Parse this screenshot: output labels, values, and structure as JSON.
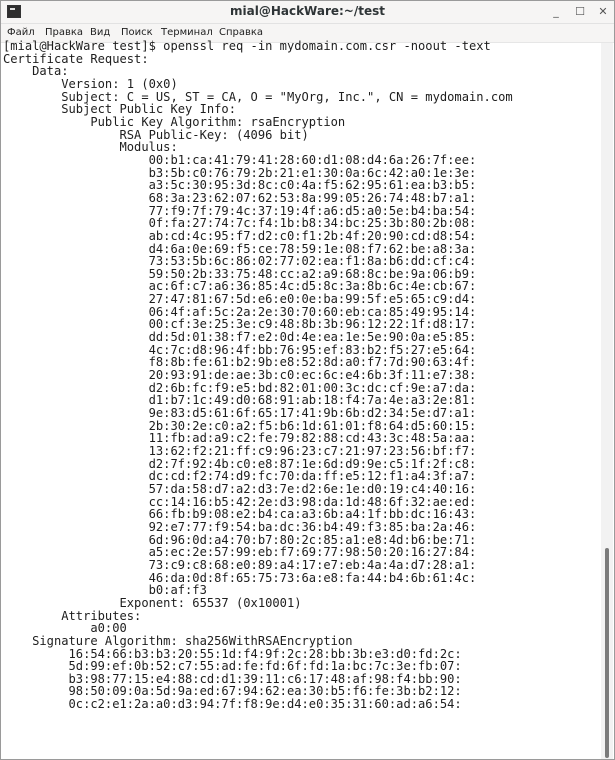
{
  "window": {
    "title": "mial@HackWare:~/test",
    "controls": {
      "minimize": "_",
      "maximize": "☐",
      "close": "✕"
    }
  },
  "menu": {
    "items": [
      "Файл",
      "Правка",
      "Вид",
      "Поиск",
      "Терминал",
      "Справка"
    ]
  },
  "terminal": {
    "lines": [
      "[mial@HackWare test]$ openssl req -in mydomain.com.csr -noout -text",
      "Certificate Request:",
      "    Data:",
      "        Version: 1 (0x0)",
      "        Subject: C = US, ST = CA, O = \"MyOrg, Inc.\", CN = mydomain.com",
      "        Subject Public Key Info:",
      "            Public Key Algorithm: rsaEncryption",
      "                RSA Public-Key: (4096 bit)",
      "                Modulus:",
      "                    00:b1:ca:41:79:41:28:60:d1:08:d4:6a:26:7f:ee:",
      "                    b3:5b:c0:76:79:2b:21:e1:30:0a:6c:42:a0:1e:3e:",
      "                    a3:5c:30:95:3d:8c:c0:4a:f5:62:95:61:ea:b3:b5:",
      "                    68:3a:23:62:07:62:53:8a:99:05:26:74:48:b7:a1:",
      "                    77:f9:7f:79:4c:37:19:4f:a6:d5:a0:5e:b4:ba:54:",
      "                    0f:fa:27:74:7c:f4:1b:b8:34:bc:25:3b:80:2b:08:",
      "                    ab:cd:4c:95:f7:d2:c0:f1:2b:4f:20:90:cd:d8:54:",
      "                    d4:6a:0e:69:f5:ce:78:59:1e:08:f7:62:be:a8:3a:",
      "                    73:53:5b:6c:86:02:77:02:ea:f1:8a:b6:dd:cf:c4:",
      "                    59:50:2b:33:75:48:cc:a2:a9:68:8c:be:9a:06:b9:",
      "                    ac:6f:c7:a6:36:85:4c:d5:8c:3a:8b:6c:4e:cb:67:",
      "                    27:47:81:67:5d:e6:e0:0e:ba:99:5f:e5:65:c9:d4:",
      "                    06:4f:af:5c:2a:2e:30:70:60:eb:ca:85:49:95:14:",
      "                    00:cf:3e:25:3e:c9:48:8b:3b:96:12:22:1f:d8:17:",
      "                    dd:5d:01:38:f7:e2:0d:4e:ea:1e:5e:90:0a:e5:85:",
      "                    4c:7c:d8:96:4f:bb:76:95:ef:83:b2:f5:27:e5:64:",
      "                    f8:8b:fe:61:b2:9b:e8:52:8d:a0:f7:7d:90:63:4f:",
      "                    20:93:91:de:ae:3b:c0:ec:6c:e4:6b:3f:11:e7:38:",
      "                    d2:6b:fc:f9:e5:bd:82:01:00:3c:dc:cf:9e:a7:da:",
      "                    d1:b7:1c:49:d0:68:91:ab:18:f4:7a:4e:a3:2e:81:",
      "                    9e:83:d5:61:6f:65:17:41:9b:6b:d2:34:5e:d7:a1:",
      "                    2b:30:2e:c0:a2:f5:b6:1d:61:01:f8:64:d5:60:15:",
      "                    11:fb:ad:a9:c2:fe:79:82:88:cd:43:3c:48:5a:aa:",
      "                    13:62:f2:21:ff:c9:96:23:c7:21:97:23:56:bf:f7:",
      "                    d2:7f:92:4b:c0:e8:87:1e:6d:d9:9e:c5:1f:2f:c8:",
      "                    dc:cd:f2:74:d9:fc:70:da:ff:e5:12:f1:a4:3f:a7:",
      "                    57:da:58:d7:a2:d3:7e:d2:6e:1e:d0:19:c4:40:16:",
      "                    cc:14:16:b5:42:2e:d3:98:da:1d:48:6f:32:ae:ed:",
      "                    66:fb:b9:08:e2:b4:ca:a3:6b:a4:1f:bb:dc:16:43:",
      "                    92:e7:77:f9:54:ba:dc:36:b4:49:f3:85:ba:2a:46:",
      "                    6d:96:0d:a4:70:b7:80:2c:85:a1:e8:4d:b6:be:71:",
      "                    a5:ec:2e:57:99:eb:f7:69:77:98:50:20:16:27:84:",
      "                    73:c9:c8:68:e0:89:a4:17:e7:eb:4a:4a:d7:28:a1:",
      "                    46:da:0d:8f:65:75:73:6a:e8:fa:44:b4:6b:61:4c:",
      "                    b0:af:f3",
      "                Exponent: 65537 (0x10001)",
      "        Attributes:",
      "            a0:00",
      "    Signature Algorithm: sha256WithRSAEncryption",
      "         16:54:66:b3:b3:20:55:1d:f4:9f:2c:28:bb:3b:e3:d0:fd:2c:",
      "         5d:99:ef:0b:52:c7:55:ad:fe:fd:6f:fd:1a:bc:7c:3e:fb:07:",
      "         b3:98:77:15:e4:88:cd:d1:39:11:c6:17:48:af:98:f4:bb:90:",
      "         98:50:09:0a:5d:9a:ed:67:94:62:ea:30:b5:f6:fe:3b:b2:12:",
      "         0c:c2:e1:2a:a0:d3:94:7f:f8:9e:d4:e0:35:31:60:ad:a6:54:"
    ]
  }
}
